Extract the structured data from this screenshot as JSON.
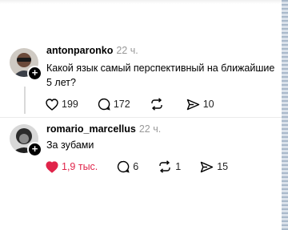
{
  "posts": [
    {
      "username": "antonparonko",
      "time": "22 ч.",
      "text": "Какой язык самый перспективный на ближайшие 5 лет?",
      "likes": "199",
      "comments": "172",
      "reposts": "",
      "shares": "10",
      "liked": false
    },
    {
      "username": "romario_marcellus",
      "time": "22 ч.",
      "text": "За зубами",
      "likes": "1,9 тыс.",
      "comments": "6",
      "reposts": "1",
      "shares": "15",
      "liked": true
    }
  ],
  "colors": {
    "like_active": "#e0244a",
    "text": "#000000",
    "muted": "#999999"
  }
}
